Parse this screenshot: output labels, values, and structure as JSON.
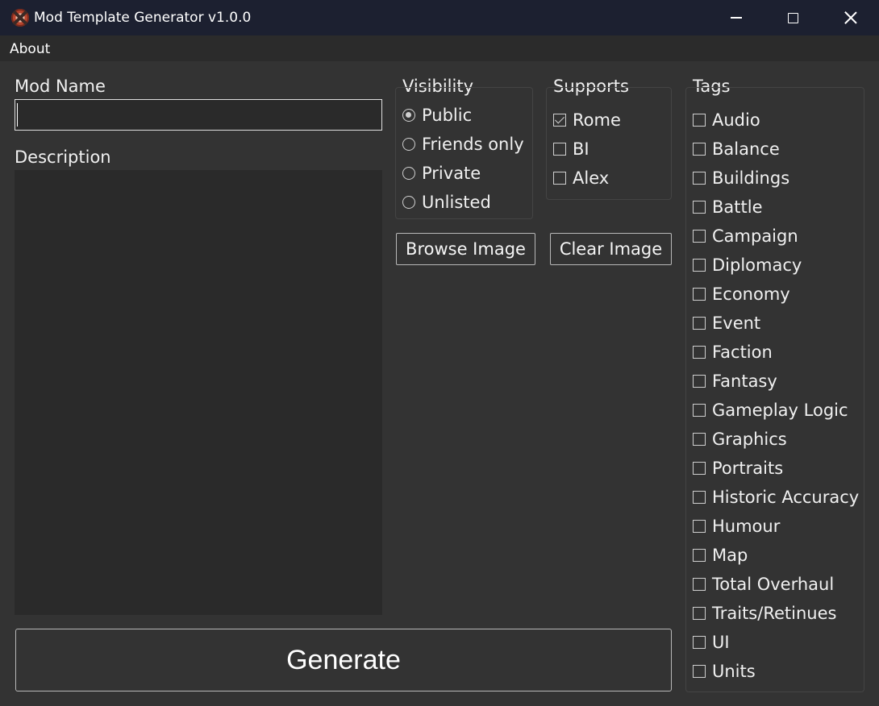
{
  "window": {
    "title": "Mod Template Generator v1.0.0"
  },
  "menu": {
    "about": "About"
  },
  "form": {
    "mod_name_label": "Mod Name",
    "mod_name_value": "",
    "description_label": "Description",
    "description_value": ""
  },
  "visibility": {
    "label": "Visibility",
    "options": [
      {
        "label": "Public",
        "checked": true
      },
      {
        "label": "Friends only",
        "checked": false
      },
      {
        "label": "Private",
        "checked": false
      },
      {
        "label": "Unlisted",
        "checked": false
      }
    ]
  },
  "supports": {
    "label": "Supports",
    "options": [
      {
        "label": "Rome",
        "checked": true
      },
      {
        "label": "BI",
        "checked": false
      },
      {
        "label": "Alex",
        "checked": false
      }
    ]
  },
  "image_buttons": {
    "browse": "Browse Image",
    "clear": "Clear Image"
  },
  "tags": {
    "label": "Tags",
    "items": [
      {
        "label": "Audio",
        "checked": false
      },
      {
        "label": "Balance",
        "checked": false
      },
      {
        "label": "Buildings",
        "checked": false
      },
      {
        "label": "Battle",
        "checked": false
      },
      {
        "label": "Campaign",
        "checked": false
      },
      {
        "label": "Diplomacy",
        "checked": false
      },
      {
        "label": "Economy",
        "checked": false
      },
      {
        "label": "Event",
        "checked": false
      },
      {
        "label": "Faction",
        "checked": false
      },
      {
        "label": "Fantasy",
        "checked": false
      },
      {
        "label": "Gameplay Logic",
        "checked": false
      },
      {
        "label": "Graphics",
        "checked": false
      },
      {
        "label": "Portraits",
        "checked": false
      },
      {
        "label": "Historic Accuracy",
        "checked": false
      },
      {
        "label": "Humour",
        "checked": false
      },
      {
        "label": "Map",
        "checked": false
      },
      {
        "label": "Total Overhaul",
        "checked": false
      },
      {
        "label": "Traits/Retinues",
        "checked": false
      },
      {
        "label": "UI",
        "checked": false
      },
      {
        "label": "Units",
        "checked": false
      }
    ]
  },
  "generate_label": "Generate",
  "colors": {
    "titlebar": "#1c2030",
    "menubar": "#2b2b2b",
    "client": "#333333",
    "input_bg": "#2a2a2a"
  }
}
